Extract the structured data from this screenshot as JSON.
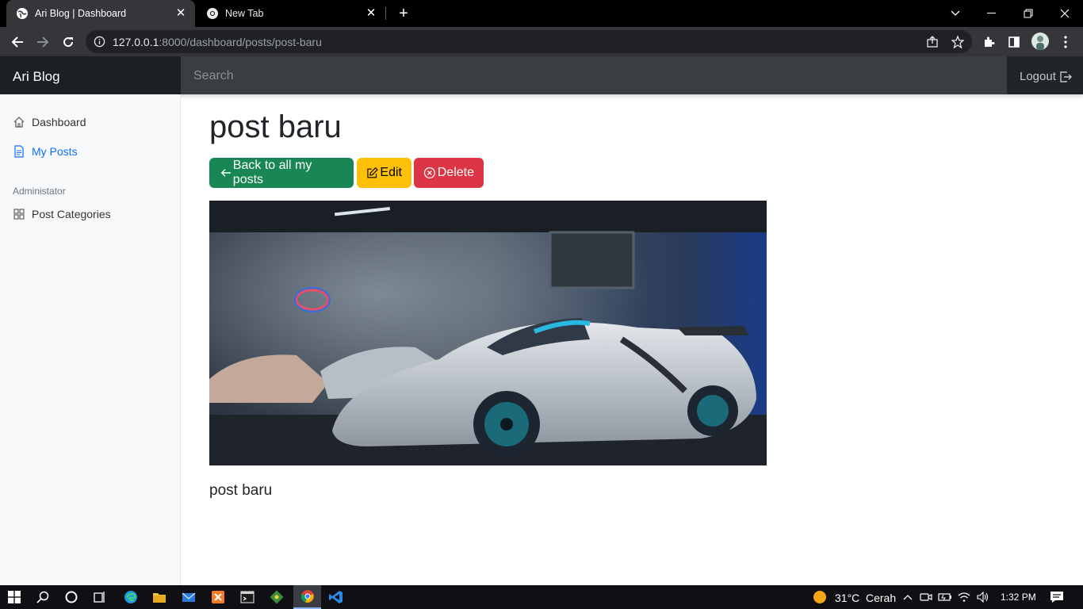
{
  "browser": {
    "tabs": [
      {
        "title": "Ari Blog | Dashboard",
        "active": true
      },
      {
        "title": "New Tab",
        "active": false
      }
    ],
    "url_host": "127.0.0.1",
    "url_rest": ":8000/dashboard/posts/post-baru"
  },
  "navbar": {
    "brand": "Ari Blog",
    "search_placeholder": "Search",
    "logout_label": "Logout"
  },
  "sidebar": {
    "items": [
      {
        "label": "Dashboard",
        "icon": "house-icon",
        "active": false
      },
      {
        "label": "My Posts",
        "icon": "file-text-icon",
        "active": true
      }
    ],
    "admin_heading": "Administator",
    "admin_items": [
      {
        "label": "Post Categories",
        "icon": "grid-icon"
      }
    ]
  },
  "post": {
    "title": "post baru",
    "back_label": "Back to all my posts",
    "edit_label": "Edit",
    "delete_label": "Delete",
    "body": "post baru"
  },
  "taskbar": {
    "weather_temp": "31°C",
    "weather_desc": "Cerah",
    "time": "1:32 PM"
  },
  "colors": {
    "success": "#198754",
    "warning": "#ffc107",
    "danger": "#dc3545",
    "primary": "#0d6efd",
    "navbar": "#212529"
  }
}
